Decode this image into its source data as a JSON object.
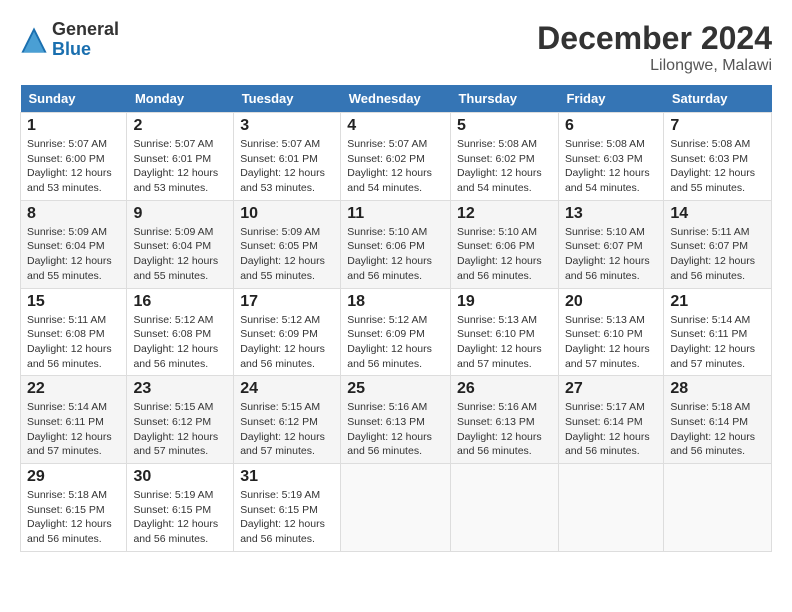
{
  "header": {
    "logo_general": "General",
    "logo_blue": "Blue",
    "month": "December 2024",
    "location": "Lilongwe, Malawi"
  },
  "days_of_week": [
    "Sunday",
    "Monday",
    "Tuesday",
    "Wednesday",
    "Thursday",
    "Friday",
    "Saturday"
  ],
  "weeks": [
    [
      {
        "day": "1",
        "info": "Sunrise: 5:07 AM\nSunset: 6:00 PM\nDaylight: 12 hours\nand 53 minutes."
      },
      {
        "day": "2",
        "info": "Sunrise: 5:07 AM\nSunset: 6:01 PM\nDaylight: 12 hours\nand 53 minutes."
      },
      {
        "day": "3",
        "info": "Sunrise: 5:07 AM\nSunset: 6:01 PM\nDaylight: 12 hours\nand 53 minutes."
      },
      {
        "day": "4",
        "info": "Sunrise: 5:07 AM\nSunset: 6:02 PM\nDaylight: 12 hours\nand 54 minutes."
      },
      {
        "day": "5",
        "info": "Sunrise: 5:08 AM\nSunset: 6:02 PM\nDaylight: 12 hours\nand 54 minutes."
      },
      {
        "day": "6",
        "info": "Sunrise: 5:08 AM\nSunset: 6:03 PM\nDaylight: 12 hours\nand 54 minutes."
      },
      {
        "day": "7",
        "info": "Sunrise: 5:08 AM\nSunset: 6:03 PM\nDaylight: 12 hours\nand 55 minutes."
      }
    ],
    [
      {
        "day": "8",
        "info": "Sunrise: 5:09 AM\nSunset: 6:04 PM\nDaylight: 12 hours\nand 55 minutes."
      },
      {
        "day": "9",
        "info": "Sunrise: 5:09 AM\nSunset: 6:04 PM\nDaylight: 12 hours\nand 55 minutes."
      },
      {
        "day": "10",
        "info": "Sunrise: 5:09 AM\nSunset: 6:05 PM\nDaylight: 12 hours\nand 55 minutes."
      },
      {
        "day": "11",
        "info": "Sunrise: 5:10 AM\nSunset: 6:06 PM\nDaylight: 12 hours\nand 56 minutes."
      },
      {
        "day": "12",
        "info": "Sunrise: 5:10 AM\nSunset: 6:06 PM\nDaylight: 12 hours\nand 56 minutes."
      },
      {
        "day": "13",
        "info": "Sunrise: 5:10 AM\nSunset: 6:07 PM\nDaylight: 12 hours\nand 56 minutes."
      },
      {
        "day": "14",
        "info": "Sunrise: 5:11 AM\nSunset: 6:07 PM\nDaylight: 12 hours\nand 56 minutes."
      }
    ],
    [
      {
        "day": "15",
        "info": "Sunrise: 5:11 AM\nSunset: 6:08 PM\nDaylight: 12 hours\nand 56 minutes."
      },
      {
        "day": "16",
        "info": "Sunrise: 5:12 AM\nSunset: 6:08 PM\nDaylight: 12 hours\nand 56 minutes."
      },
      {
        "day": "17",
        "info": "Sunrise: 5:12 AM\nSunset: 6:09 PM\nDaylight: 12 hours\nand 56 minutes."
      },
      {
        "day": "18",
        "info": "Sunrise: 5:12 AM\nSunset: 6:09 PM\nDaylight: 12 hours\nand 56 minutes."
      },
      {
        "day": "19",
        "info": "Sunrise: 5:13 AM\nSunset: 6:10 PM\nDaylight: 12 hours\nand 57 minutes."
      },
      {
        "day": "20",
        "info": "Sunrise: 5:13 AM\nSunset: 6:10 PM\nDaylight: 12 hours\nand 57 minutes."
      },
      {
        "day": "21",
        "info": "Sunrise: 5:14 AM\nSunset: 6:11 PM\nDaylight: 12 hours\nand 57 minutes."
      }
    ],
    [
      {
        "day": "22",
        "info": "Sunrise: 5:14 AM\nSunset: 6:11 PM\nDaylight: 12 hours\nand 57 minutes."
      },
      {
        "day": "23",
        "info": "Sunrise: 5:15 AM\nSunset: 6:12 PM\nDaylight: 12 hours\nand 57 minutes."
      },
      {
        "day": "24",
        "info": "Sunrise: 5:15 AM\nSunset: 6:12 PM\nDaylight: 12 hours\nand 57 minutes."
      },
      {
        "day": "25",
        "info": "Sunrise: 5:16 AM\nSunset: 6:13 PM\nDaylight: 12 hours\nand 56 minutes."
      },
      {
        "day": "26",
        "info": "Sunrise: 5:16 AM\nSunset: 6:13 PM\nDaylight: 12 hours\nand 56 minutes."
      },
      {
        "day": "27",
        "info": "Sunrise: 5:17 AM\nSunset: 6:14 PM\nDaylight: 12 hours\nand 56 minutes."
      },
      {
        "day": "28",
        "info": "Sunrise: 5:18 AM\nSunset: 6:14 PM\nDaylight: 12 hours\nand 56 minutes."
      }
    ],
    [
      {
        "day": "29",
        "info": "Sunrise: 5:18 AM\nSunset: 6:15 PM\nDaylight: 12 hours\nand 56 minutes."
      },
      {
        "day": "30",
        "info": "Sunrise: 5:19 AM\nSunset: 6:15 PM\nDaylight: 12 hours\nand 56 minutes."
      },
      {
        "day": "31",
        "info": "Sunrise: 5:19 AM\nSunset: 6:15 PM\nDaylight: 12 hours\nand 56 minutes."
      },
      {
        "day": "",
        "info": ""
      },
      {
        "day": "",
        "info": ""
      },
      {
        "day": "",
        "info": ""
      },
      {
        "day": "",
        "info": ""
      }
    ]
  ]
}
